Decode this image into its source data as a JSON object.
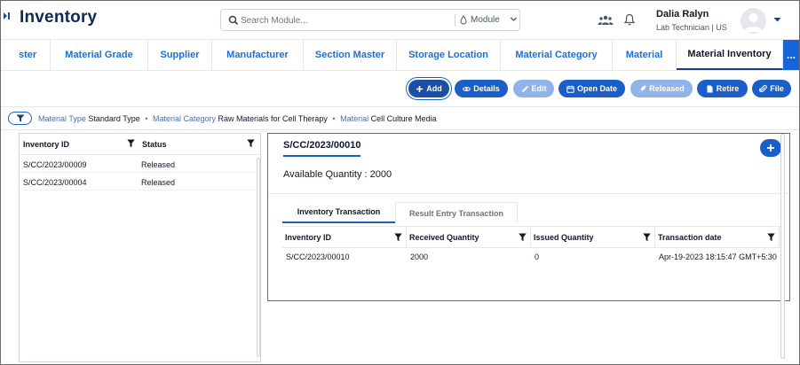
{
  "header": {
    "app_title": "Inventory",
    "search_placeholder": "Search Module...",
    "module_label": "Module",
    "user_name": "Dalia Ralyn",
    "user_role": "Lab Technician | US"
  },
  "tabs": [
    {
      "label": "ster"
    },
    {
      "label": "Material Grade"
    },
    {
      "label": "Supplier"
    },
    {
      "label": "Manufacturer"
    },
    {
      "label": "Section Master"
    },
    {
      "label": "Storage Location"
    },
    {
      "label": "Material Category"
    },
    {
      "label": "Material"
    },
    {
      "label": "Material Inventory",
      "active": true
    }
  ],
  "tabs_more_label": "...",
  "toolbar": {
    "add": "Add",
    "details": "Details",
    "edit": "Edit",
    "open_date": "Open Date",
    "released": "Released",
    "retire": "Retire",
    "file": "File"
  },
  "filters": {
    "type_label": "Material Type",
    "type_value": "Standard Type",
    "category_label": "Material Category",
    "category_value": "Raw Materials for Cell Therapy",
    "material_label": "Material",
    "material_value": "Cell Culture Media",
    "separator": "•"
  },
  "list": {
    "columns": [
      "Inventory ID",
      "Status"
    ],
    "rows": [
      {
        "id": "S/CC/2023/00009",
        "status": "Released"
      },
      {
        "id": "S/CC/2023/00004",
        "status": "Released"
      }
    ]
  },
  "detail": {
    "title": "S/CC/2023/00010",
    "available_quantity": "Available Quantity : 2000",
    "subtabs": [
      "Inventory Transaction",
      "Result Entry Transaction"
    ],
    "grid_columns": [
      "Inventory ID",
      "Received Quantity",
      "Issued Quantity",
      "Transaction date"
    ],
    "grid_rows": [
      {
        "inventory_id": "S/CC/2023/00010",
        "received": "2000",
        "issued": "0",
        "date": "Apr-19-2023 18:15:47 GMT+5:30"
      }
    ]
  },
  "colors": {
    "primary": "#1a5fc9",
    "primary_disabled": "#8fb4ea",
    "title": "#0f2a52",
    "tab_text": "#1f6fd1"
  }
}
